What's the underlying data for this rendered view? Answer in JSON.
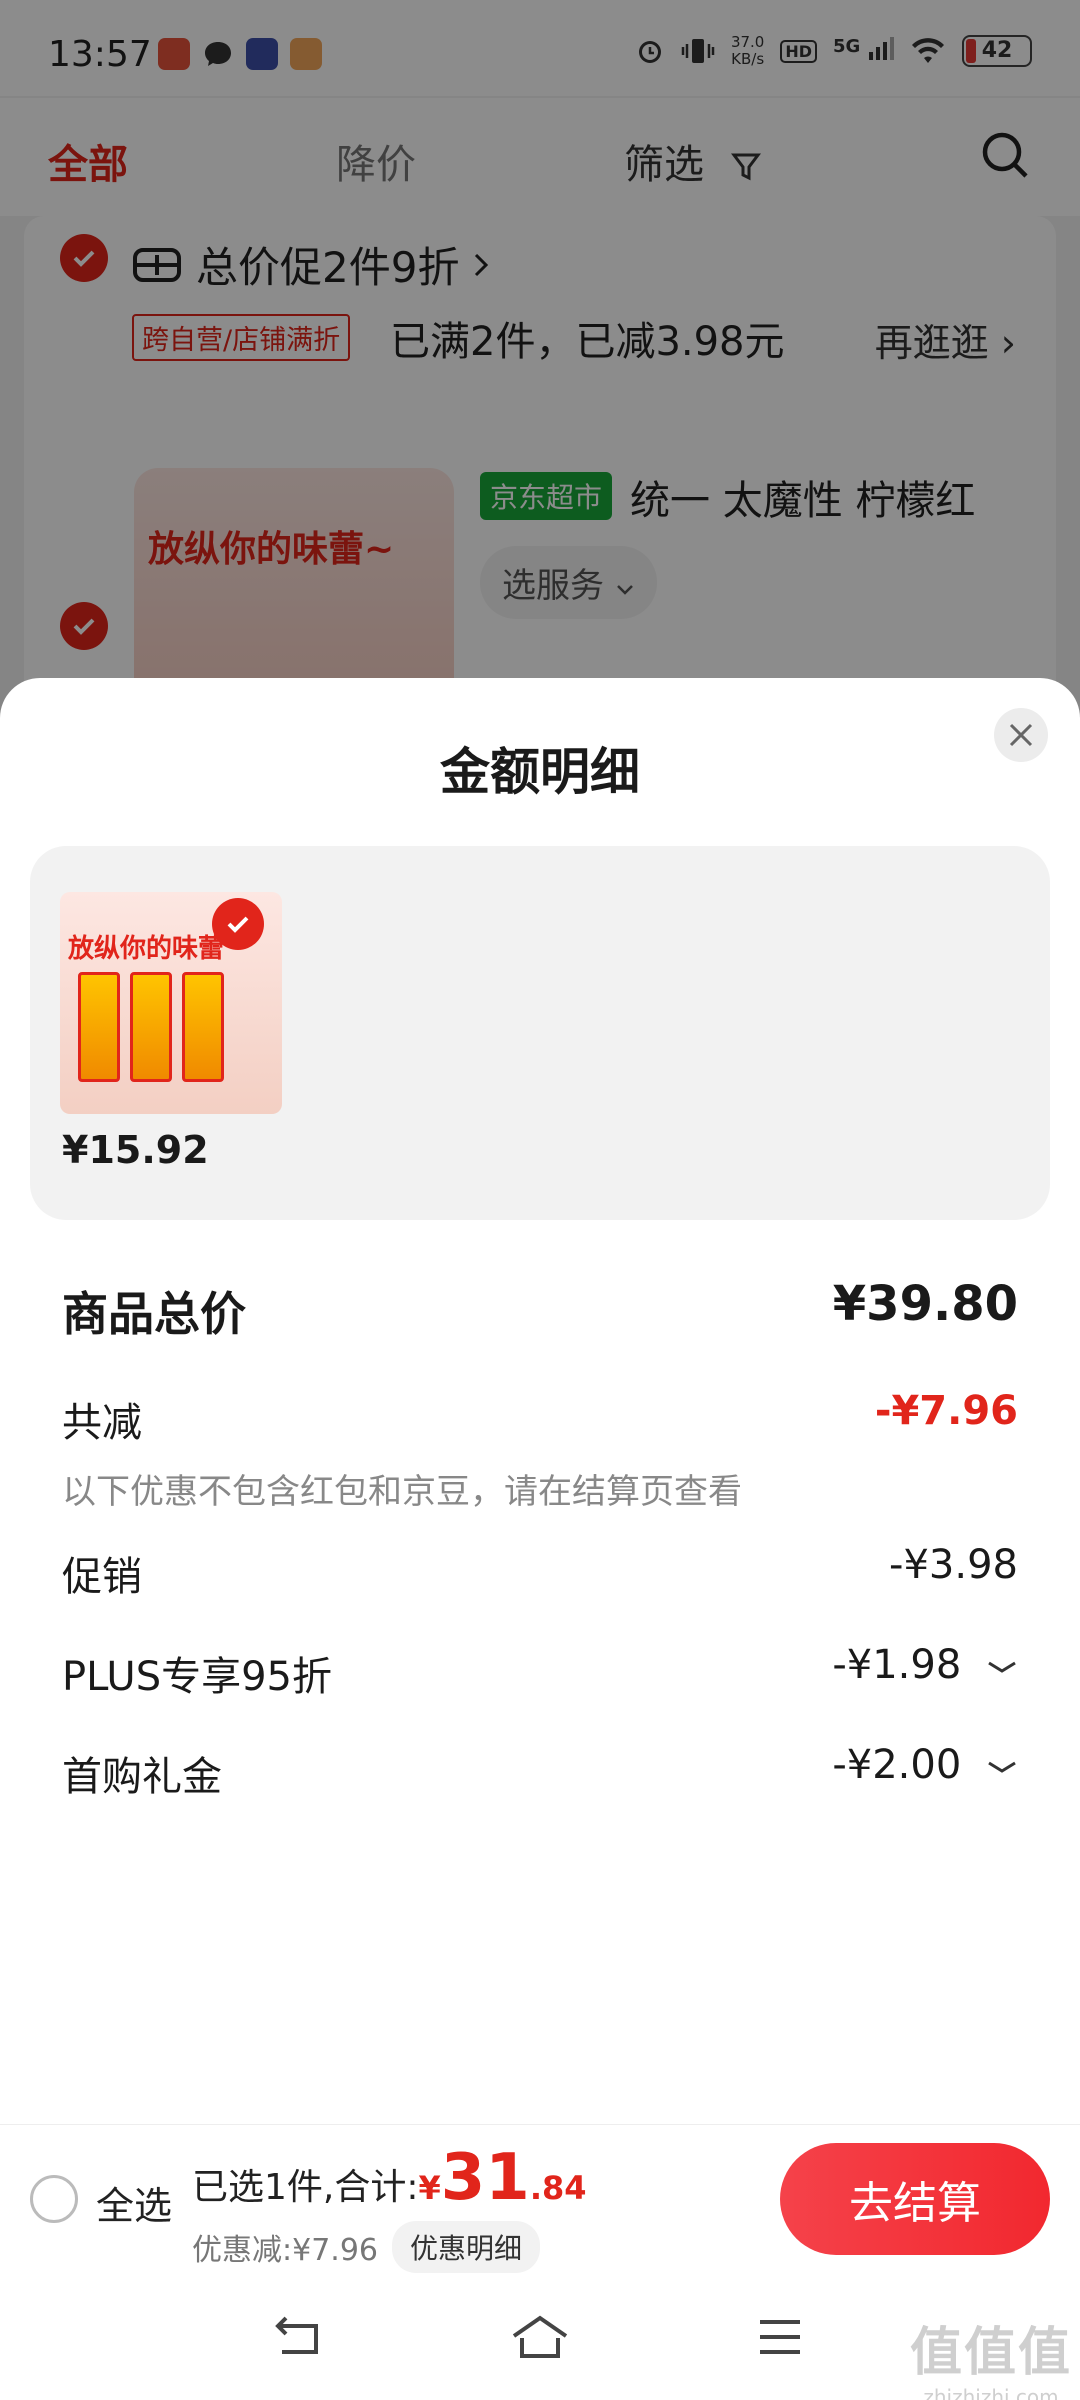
{
  "status_bar": {
    "time": "13:57",
    "net_speed_value": "37.0",
    "net_speed_unit": "KB/s",
    "hd": "HD",
    "signal": "5G",
    "battery": "42"
  },
  "top_tabs": {
    "all": "全部",
    "price_drop": "降价",
    "filter": "筛选"
  },
  "cart_bg": {
    "promo_title": "总价促2件9折",
    "promo_tag": "跨自营/店铺满折",
    "promo_desc": "已满2件，已减3.98元",
    "promo_more": "再逛逛",
    "product_image_text": "放纵你的味蕾~",
    "shop_badge": "京东超市",
    "product_name": "统一 太魔性 柠檬红",
    "service": "选服务"
  },
  "sheet": {
    "title": "金额明细",
    "product_image_text": "放纵你的味蕾",
    "product_price": "¥15.92",
    "total_label": "商品总价",
    "total_value": "¥39.80",
    "reduction_label": "共减",
    "reduction_value": "-¥7.96",
    "note": "以下优惠不包含红包和京豆，请在结算页查看",
    "rows": [
      {
        "label": "促销",
        "value": "-¥3.98"
      },
      {
        "label": "PLUS专享95折",
        "value": "-¥1.98"
      },
      {
        "label": "首购礼金",
        "value": "-¥2.00"
      }
    ]
  },
  "bottom_bar": {
    "select_all": "全选",
    "selected_text": "已选1件,合计:",
    "currency": "¥",
    "total_int": "31",
    "total_dec": ".84",
    "discount_text": "优惠减:¥7.96",
    "detail_button": "优惠明细",
    "checkout_button": "去结算"
  },
  "watermark": {
    "glyphs": "值值值",
    "domain": "zhizhizhi.com"
  },
  "colors": {
    "brand_red": "#e1251b",
    "jd_green": "#19a83a"
  }
}
